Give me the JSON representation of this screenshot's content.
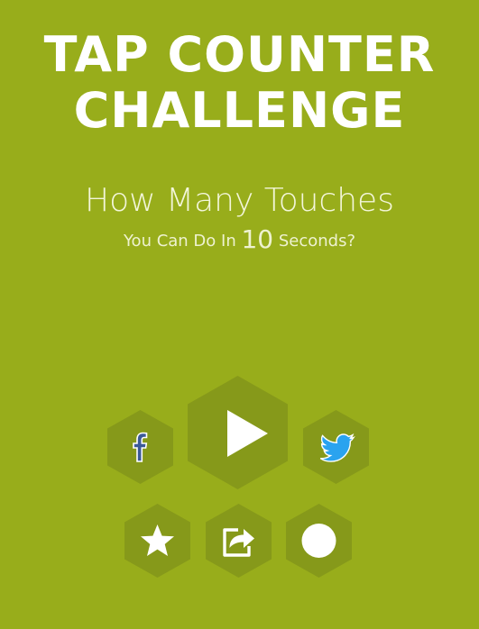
{
  "title": {
    "line1": "TAP COUNTER",
    "line2": "CHALLENGE"
  },
  "question": {
    "line1": "How Many Touches",
    "line2_prefix": "You Can Do In",
    "seconds": "10",
    "line2_suffix": "Seconds?"
  },
  "buttons": [
    {
      "id": "facebook",
      "icon": "facebook-icon"
    },
    {
      "id": "play",
      "icon": "play-icon"
    },
    {
      "id": "twitter",
      "icon": "twitter-icon"
    },
    {
      "id": "rate",
      "icon": "star-icon"
    },
    {
      "id": "share",
      "icon": "share-icon"
    },
    {
      "id": "record",
      "icon": "circle-icon"
    }
  ],
  "colors": {
    "background": "#98ad1b",
    "hex": "#86991a",
    "facebook": "#3b5998",
    "twitter": "#2aa3ef"
  }
}
